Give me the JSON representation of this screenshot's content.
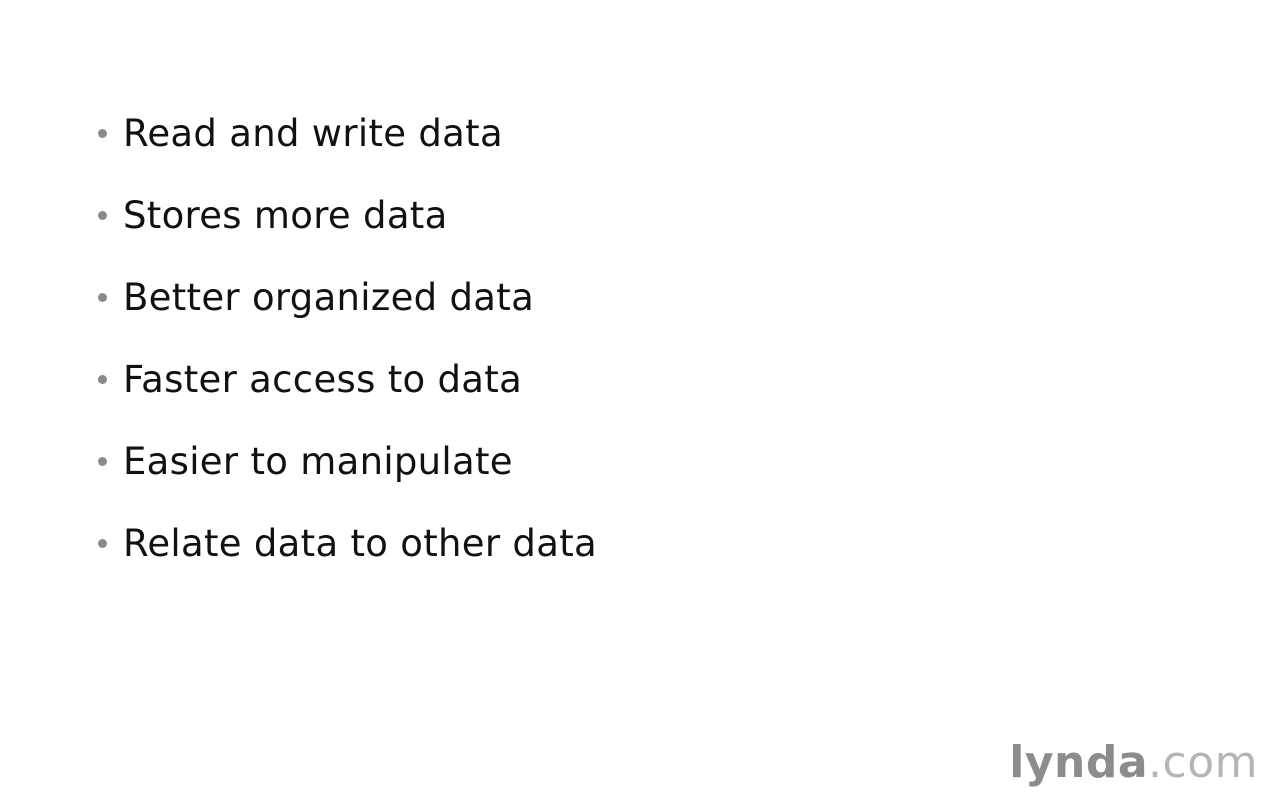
{
  "bullets": [
    "Read and write data",
    "Stores more data",
    "Better organized data",
    "Faster access to data",
    "Easier to manipulate",
    "Relate data to other data"
  ],
  "watermark": {
    "part1": "lynda",
    "part2": ".com"
  },
  "colors": {
    "background": "#ffffff",
    "text": "#111111",
    "bullet": "#8a8a8a",
    "watermark_primary": "#8c8c8c",
    "watermark_secondary": "#b5b5b5"
  }
}
